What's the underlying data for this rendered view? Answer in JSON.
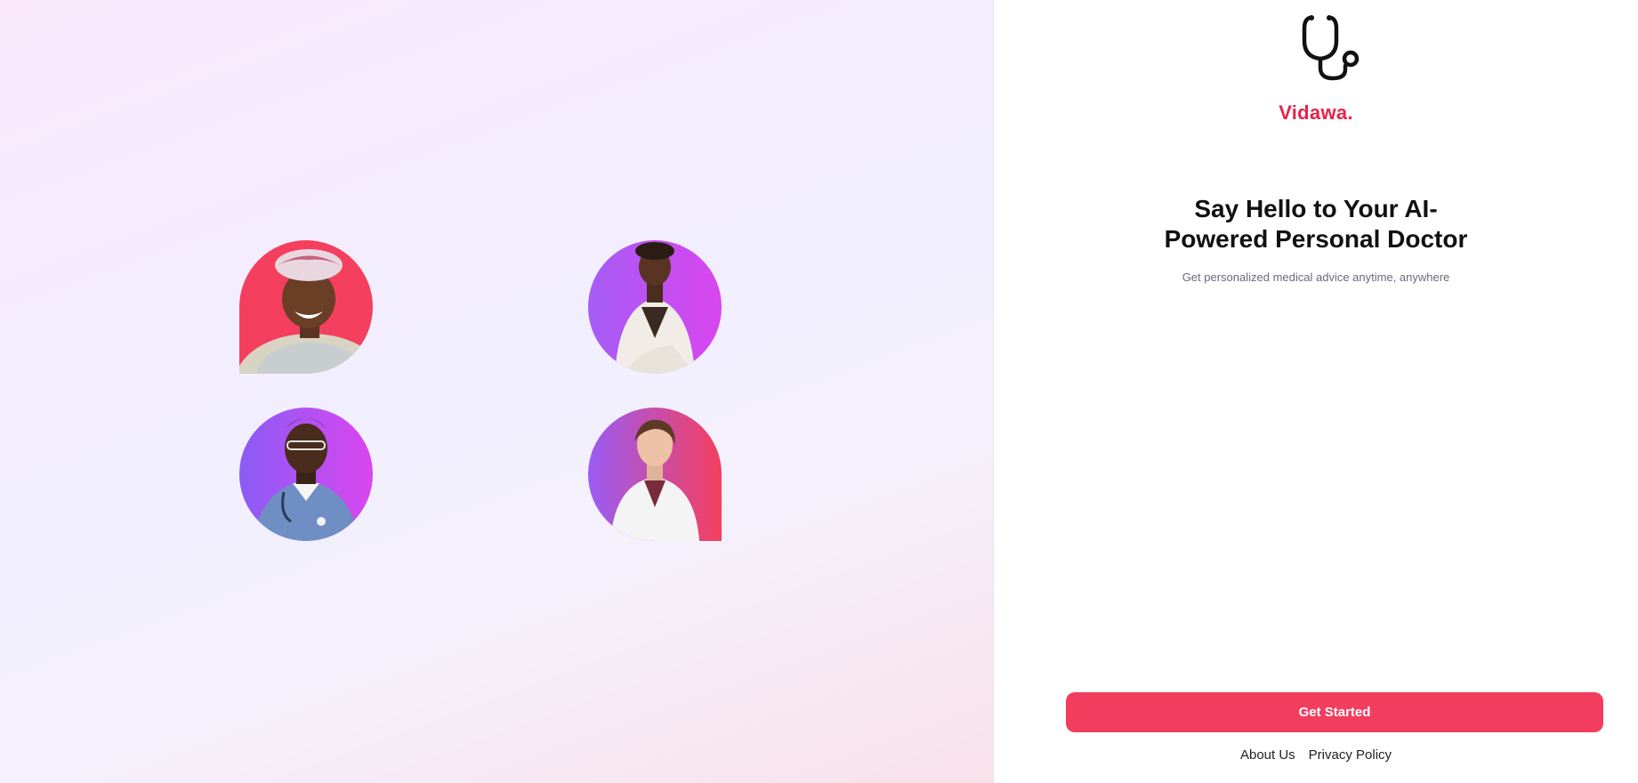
{
  "brand": {
    "name": "Vidawa.",
    "color": "#e8234a",
    "logo_icon": "stethoscope-icon"
  },
  "hero": {
    "headline": "Say Hello to Your AI-Powered Personal Doctor",
    "subtitle": "Get personalized medical advice anytime, anywhere"
  },
  "actions": {
    "get_started_label": "Get Started",
    "button_color": "#f23d5e"
  },
  "footer": {
    "about_label": "About Us",
    "privacy_label": "Privacy Policy"
  },
  "gallery": {
    "images": [
      {
        "name": "patient-woman-headscarf",
        "bg": "#f43f5e"
      },
      {
        "name": "doctor-woman-white-suit",
        "bg": "#c847ee"
      },
      {
        "name": "doctor-man-scrubs",
        "bg": "#a855f7"
      },
      {
        "name": "doctor-woman-labcoat",
        "bg": "#e8405a"
      }
    ]
  }
}
